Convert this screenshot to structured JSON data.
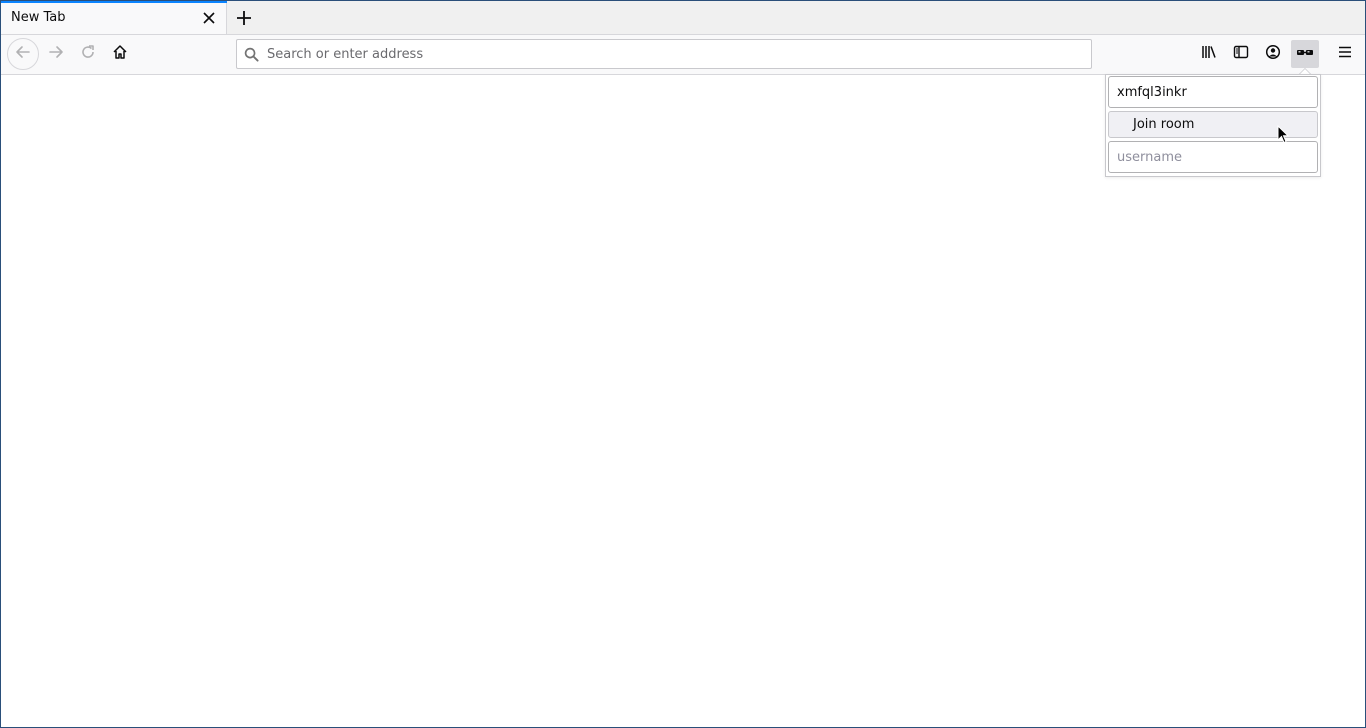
{
  "tabstrip": {
    "active_tab": {
      "title": "New Tab",
      "close_icon": "close-icon"
    },
    "new_tab_icon": "plus-icon"
  },
  "navbar": {
    "back_icon": "arrow-left-icon",
    "forward_icon": "arrow-right-icon",
    "reload_icon": "reload-icon",
    "home_icon": "home-icon",
    "urlbar": {
      "search_icon": "search-icon",
      "value": "",
      "placeholder": "Search or enter address"
    },
    "toolbar_icons": [
      "library-icon",
      "sidebar-icon",
      "account-icon",
      "extension-icon",
      "hamburger-menu-icon"
    ]
  },
  "popup": {
    "room_value": "xmfql3inkr",
    "join_label": "Join room",
    "username_value": "",
    "username_placeholder": "username"
  },
  "colors": {
    "accent": "#0a84ff",
    "toolbar_bg": "#f9f9fa",
    "tabstrip_bg": "#f0f0f0",
    "icon": "#3b3b3b"
  }
}
